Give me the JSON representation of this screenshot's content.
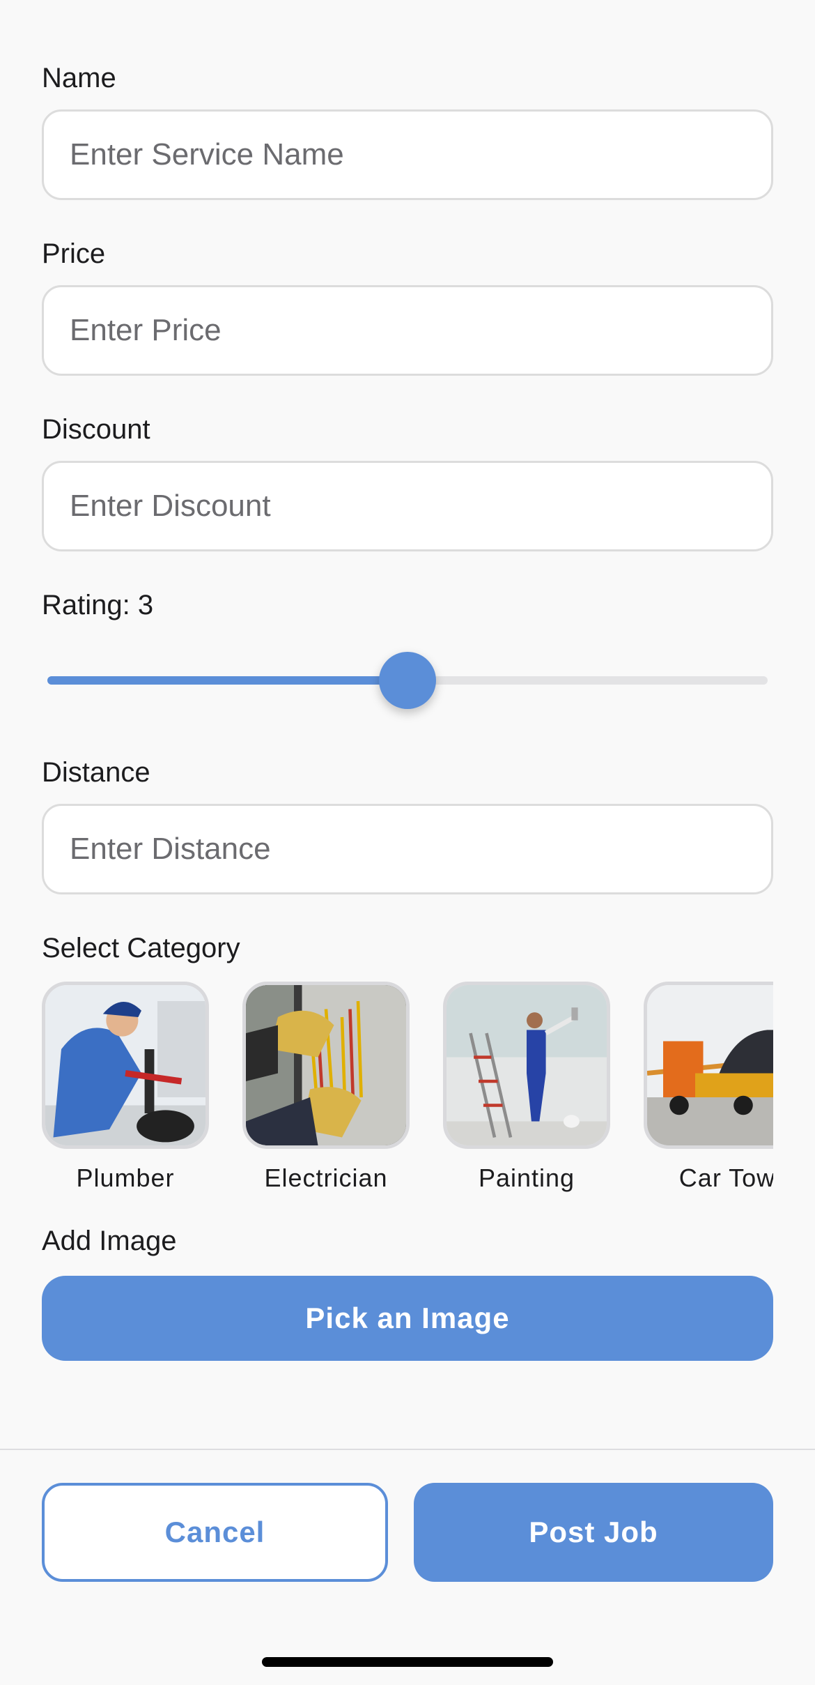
{
  "form": {
    "name": {
      "label": "Name",
      "placeholder": "Enter Service Name"
    },
    "price": {
      "label": "Price",
      "placeholder": "Enter Price"
    },
    "discount": {
      "label": "Discount",
      "placeholder": "Enter Discount"
    },
    "rating": {
      "label": "Rating: 3",
      "value": 3,
      "min": 1,
      "max": 5,
      "fill_fraction": 0.5
    },
    "distance": {
      "label": "Distance",
      "placeholder": "Enter Distance"
    },
    "category": {
      "label": "Select Category",
      "items": [
        {
          "label": "Plumber"
        },
        {
          "label": "Electrician"
        },
        {
          "label": "Painting"
        },
        {
          "label": "Car Tow"
        }
      ]
    },
    "image": {
      "label": "Add Image",
      "button_label": "Pick an Image"
    }
  },
  "footer": {
    "cancel_label": "Cancel",
    "post_label": "Post Job"
  },
  "colors": {
    "accent": "#5b8ed8",
    "background": "#f9f9f9",
    "border": "#dcdcdc"
  }
}
